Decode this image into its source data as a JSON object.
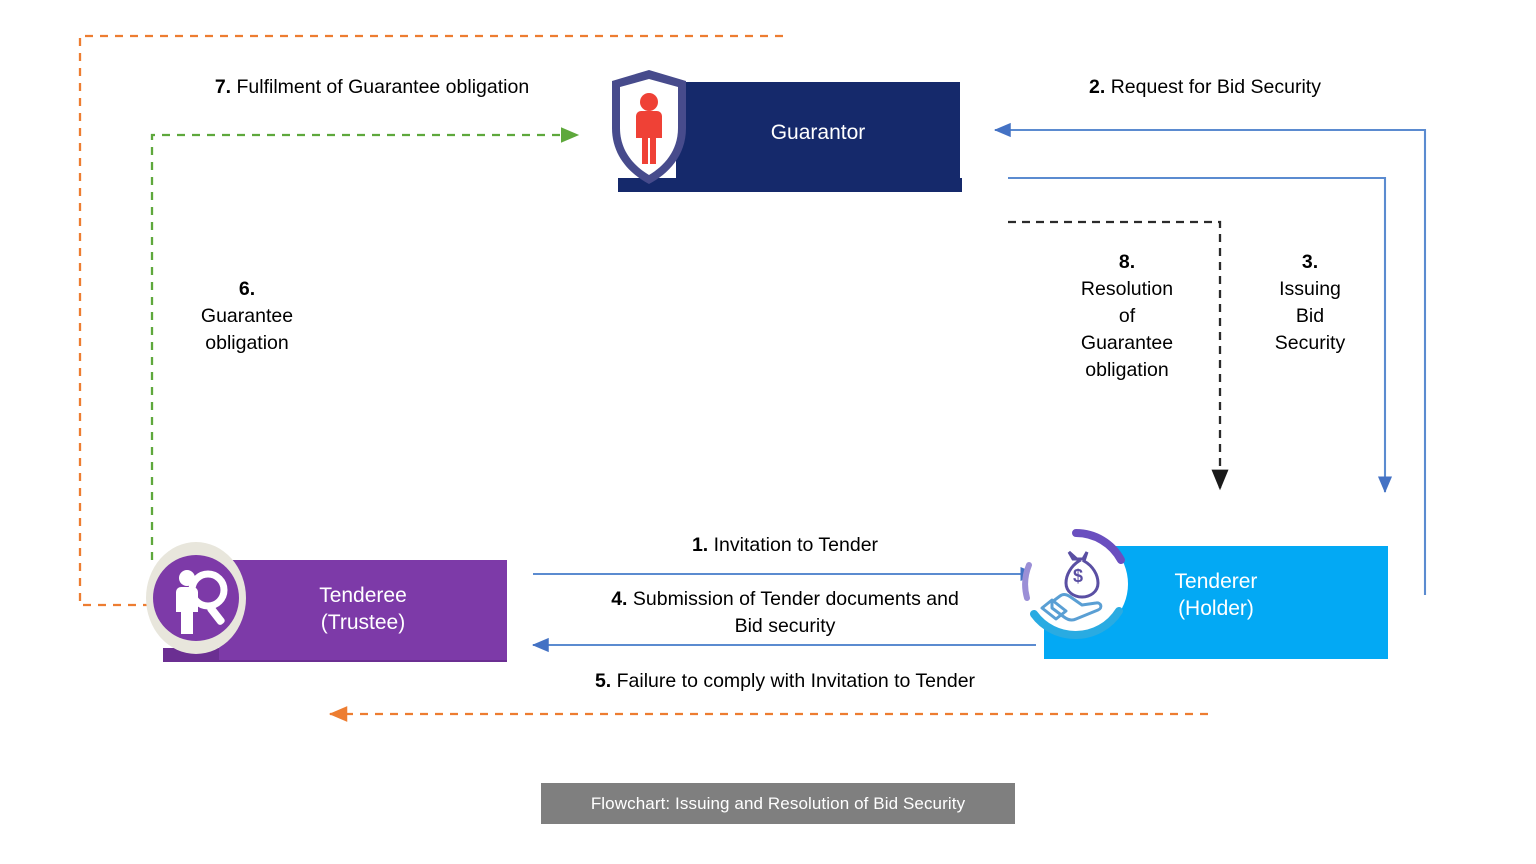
{
  "title": "Flowchart: Issuing and Resolution of Bid Security",
  "caption": {
    "text": "Flowchart: Issuing and Resolution of Bid Security",
    "bg": "#7f7f7f",
    "color": "#ffffff"
  },
  "nodes": {
    "guarantor": {
      "label": "Guarantor",
      "color": "#15296b",
      "icon": "shield-person-icon"
    },
    "tenderee": {
      "label": "Tenderee\n(Trustee)",
      "line1": "Tenderee",
      "line2": "(Trustee)",
      "color": "#7d3aa8",
      "icon": "person-magnifier-icon"
    },
    "tenderer": {
      "label": "Tenderer\n(Holder)",
      "line1": "Tenderer",
      "line2": "(Holder)",
      "color": "#03a9f4",
      "icon": "hand-money-bag-icon"
    }
  },
  "steps": [
    {
      "num": "1.",
      "text": "Invitation to Tender",
      "color": "#4472c4",
      "style": "solid",
      "from": "tenderee",
      "to": "tenderer"
    },
    {
      "num": "2.",
      "text": "Request for Bid Security",
      "color": "#4472c4",
      "style": "solid",
      "from": "tenderer",
      "to": "guarantor"
    },
    {
      "num": "3.",
      "text": "Issuing\nBid\nSecurity",
      "color": "#4472c4",
      "style": "solid",
      "from": "guarantor",
      "to": "tenderer"
    },
    {
      "num": "4.",
      "text": "Submission of Tender documents and Bid security",
      "color": "#4472c4",
      "style": "solid",
      "from": "tenderer",
      "to": "tenderee"
    },
    {
      "num": "5.",
      "text": "Failure to comply with Invitation to Tender",
      "color": "#ed7d31",
      "style": "dashed",
      "from": "tenderer",
      "to": "tenderee"
    },
    {
      "num": "6.",
      "text": "Guarantee\nobligation",
      "color": "#70ad47",
      "style": "dashed",
      "from": "tenderee",
      "to": "guarantor"
    },
    {
      "num": "7.",
      "text": "Fulfilment of Guarantee obligation",
      "color": "#ed7d31",
      "style": "dashed",
      "from": "guarantor",
      "to": "tenderee"
    },
    {
      "num": "8.",
      "text": "Resolution\nof\nGuarantee\nobligation",
      "color": "#404040",
      "style": "dashed",
      "from": "guarantor",
      "to": "tenderer"
    }
  ],
  "labels": {
    "s1_num": "1.",
    "s1_text": " Invitation to Tender",
    "s2_num": "2.",
    "s2_text": " Request for Bid Security",
    "s3_num": "3.",
    "s3_l1": "Issuing",
    "s3_l2": "Bid",
    "s3_l3": "Security",
    "s4_num": "4.",
    "s4_l1": " Submission of Tender documents and",
    "s4_l2": "Bid security",
    "s5_num": "5.",
    "s5_text": " Failure to comply with Invitation to Tender",
    "s6_num": "6.",
    "s6_l1": "Guarantee",
    "s6_l2": "obligation",
    "s7_num": "7.",
    "s7_text": " Fulfilment of Guarantee obligation",
    "s8_num": "8.",
    "s8_l1": "Resolution",
    "s8_l2": "of",
    "s8_l3": "Guarantee",
    "s8_l4": "obligation"
  },
  "colors": {
    "guarantor_navy": "#15296b",
    "tenderee_purple": "#7d3aa8",
    "tenderer_cyan": "#03a9f4",
    "arrow_blue": "#4472c4",
    "arrow_orange": "#ed7d31",
    "arrow_green": "#70ad47",
    "arrow_black": "#3f3f3f",
    "caption_gray": "#7f7f7f",
    "icon_red": "#ef4136",
    "icon_shield": "#474b8c"
  }
}
